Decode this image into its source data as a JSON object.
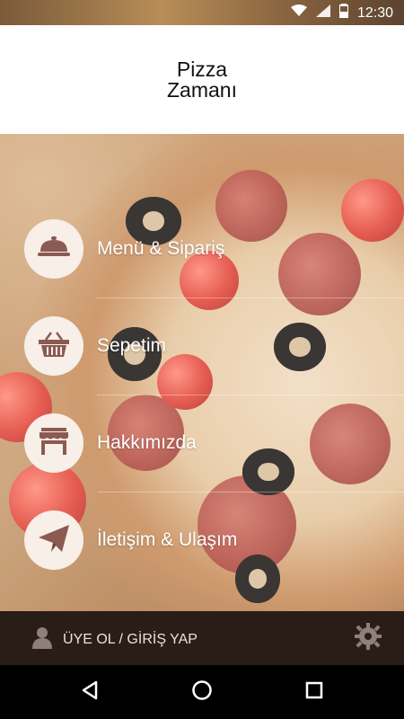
{
  "status_bar": {
    "time": "12:30",
    "icons": [
      "wifi-icon",
      "signal-icon",
      "battery-icon"
    ]
  },
  "header": {
    "logo_line1": "Pizza",
    "logo_line2": "Zamanı"
  },
  "menu": {
    "items": [
      {
        "label": "Menü & Sipariş",
        "icon": "cloche-icon"
      },
      {
        "label": "Sepetim",
        "icon": "basket-icon"
      },
      {
        "label": "Hakkımızda",
        "icon": "storefront-icon"
      },
      {
        "label": "İletişim & Ulaşım",
        "icon": "paper-plane-icon"
      }
    ]
  },
  "bottom_bar": {
    "account_label": "ÜYE OL / GİRİŞ YAP",
    "settings_icon": "gear-icon",
    "user_icon": "user-icon"
  },
  "nav_bar": {
    "icons": [
      "back-icon",
      "home-icon",
      "recents-icon"
    ]
  },
  "colors": {
    "bottom_bar_bg": "#2a1d17",
    "icon_brown": "#8b5a52",
    "circle_bg": "#f7efe8"
  }
}
